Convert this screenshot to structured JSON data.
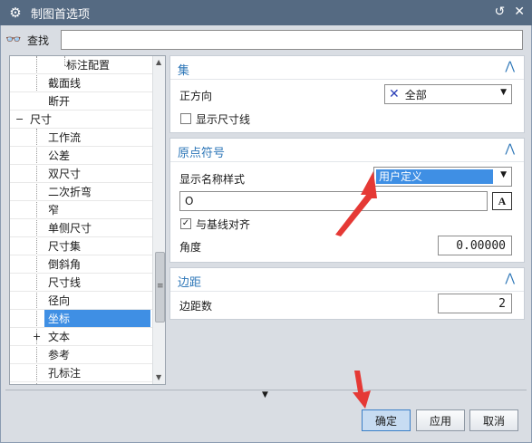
{
  "window": {
    "title": "制图首选项"
  },
  "find": {
    "label": "查找",
    "value": ""
  },
  "tree": {
    "items": [
      {
        "label": "标注配置"
      },
      {
        "label": "截面线"
      },
      {
        "label": "断开"
      },
      {
        "label": "尺寸",
        "expander": "−"
      },
      {
        "label": "工作流"
      },
      {
        "label": "公差"
      },
      {
        "label": "双尺寸"
      },
      {
        "label": "二次折弯"
      },
      {
        "label": "窄"
      },
      {
        "label": "单侧尺寸"
      },
      {
        "label": "尺寸集"
      },
      {
        "label": "倒斜角"
      },
      {
        "label": "尺寸线"
      },
      {
        "label": "径向"
      },
      {
        "label": "坐标",
        "selected": true
      },
      {
        "label": "文本",
        "expander": "+"
      },
      {
        "label": "参考"
      },
      {
        "label": "孔标注"
      }
    ]
  },
  "panel_set": {
    "title": "集",
    "direction_label": "正方向",
    "direction_value": "全部",
    "show_dim_line_label": "显示尺寸线",
    "show_dim_line_checked": false
  },
  "panel_origin": {
    "title": "原点符号",
    "name_style_label": "显示名称样式",
    "name_style_value": "用户定义",
    "text_value": "O",
    "align_baseline_label": "与基线对齐",
    "align_baseline_checked": true,
    "angle_label": "角度",
    "angle_value": "0.00000"
  },
  "panel_margin": {
    "title": "边距",
    "margin_count_label": "边距数",
    "margin_count_value": "2"
  },
  "buttons": {
    "ok": "确定",
    "apply": "应用",
    "cancel": "取消"
  },
  "icons": {
    "window": "gear-icon",
    "find": "binoculars-icon",
    "reset": "reset-icon",
    "close": "close-icon",
    "panel_collapse": "chevron-up-icon",
    "direction": "cross-arrows-icon",
    "text_style": "font-style-icon"
  },
  "colors": {
    "titlebar": "#556a82",
    "accent": "#2e77b8",
    "selection": "#3f8fe4",
    "annotation": "#e53935"
  }
}
